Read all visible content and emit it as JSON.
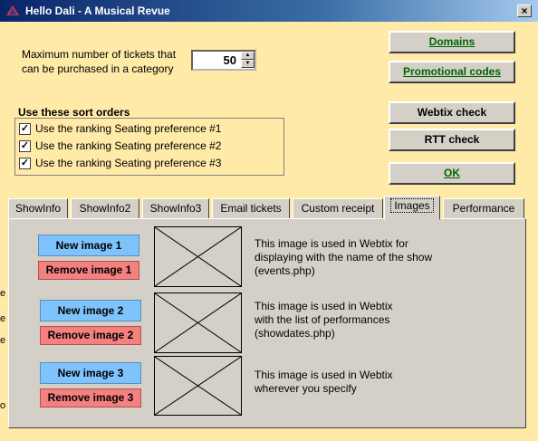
{
  "window": {
    "title": "Hello Dali - A Musical Revue",
    "close_glyph": "×"
  },
  "max_tickets": {
    "label_line1": "Maximum number of tickets that",
    "label_line2": "can be purchased in a category",
    "value": "50"
  },
  "sort_orders": {
    "title": "Use these sort orders",
    "items": [
      {
        "label": "Use the ranking Seating preference #1",
        "checked": true
      },
      {
        "label": "Use the ranking Seating preference #2",
        "checked": true
      },
      {
        "label": "Use the ranking Seating preference #3",
        "checked": true
      }
    ]
  },
  "buttons": {
    "domains": "Domains",
    "promotional_codes": "Promotional codes",
    "webtix_check": "Webtix check",
    "rtt_check": "RTT check",
    "ok": "OK"
  },
  "tabs": [
    {
      "label": "ShowInfo",
      "active": false
    },
    {
      "label": "ShowInfo2",
      "active": false
    },
    {
      "label": "ShowInfo3",
      "active": false
    },
    {
      "label": "Email tickets",
      "active": false
    },
    {
      "label": "Custom receipt",
      "active": false
    },
    {
      "label": "Images",
      "active": true
    },
    {
      "label": "Performance",
      "active": false
    }
  ],
  "images": [
    {
      "new_label": "New image 1",
      "remove_label": "Remove  image 1",
      "desc_line1": "This image is used in Webtix for",
      "desc_line2": "displaying with the name of the show",
      "desc_line3": "(events.php)"
    },
    {
      "new_label": "New image 2",
      "remove_label": "Remove image 2",
      "desc_line1": "This image is used in Webtix",
      "desc_line2": "with the list of performances",
      "desc_line3": "(showdates.php)"
    },
    {
      "new_label": "New image 3",
      "remove_label": "Remove image 3",
      "desc_line1": "This image is used in Webtix",
      "desc_line2": "wherever you specify",
      "desc_line3": ""
    }
  ],
  "edge_glyphs": [
    "e",
    "e",
    "e",
    "o"
  ],
  "colors": {
    "background": "#ffeaa8",
    "green_text": "#006400",
    "blue_button": "#7ec3fb",
    "red_button": "#f48080"
  }
}
